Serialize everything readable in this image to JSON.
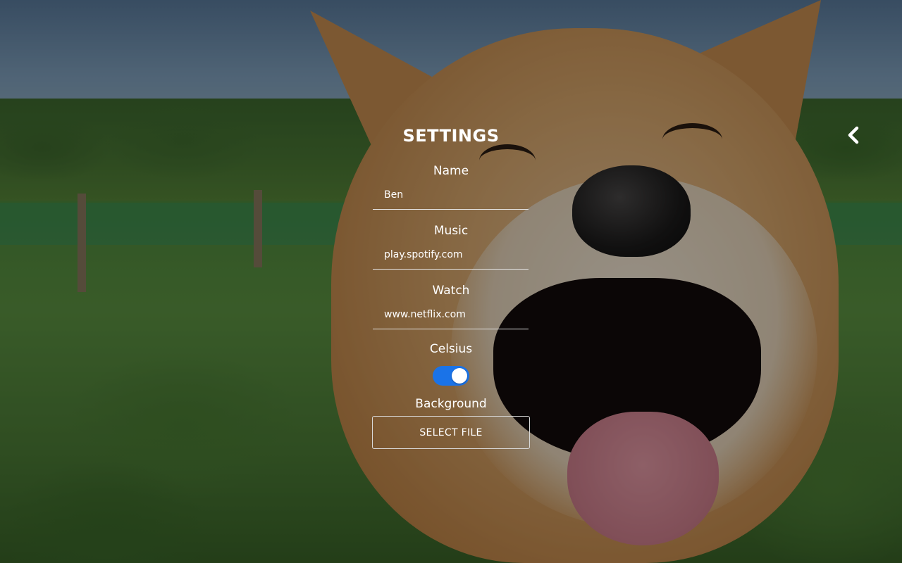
{
  "settings": {
    "title": "SETTINGS",
    "fields": {
      "name": {
        "label": "Name",
        "value": "Ben"
      },
      "music": {
        "label": "Music",
        "value": "play.spotify.com"
      },
      "watch": {
        "label": "Watch",
        "value": "www.netflix.com"
      }
    },
    "celsius": {
      "label": "Celsius",
      "enabled": true
    },
    "background": {
      "label": "Background",
      "button_label": "SELECT FILE"
    }
  },
  "nav": {
    "back_icon": "chevron-left-icon"
  },
  "colors": {
    "toggle_on": "#1a73e8",
    "text": "#ffffff",
    "overlay": "rgba(0,0,0,0.38)"
  }
}
